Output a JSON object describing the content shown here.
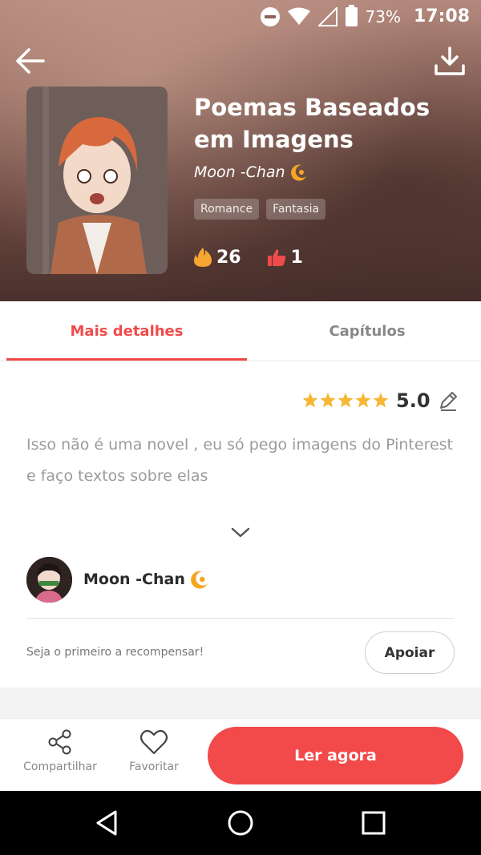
{
  "status_bar": {
    "battery_pct": "73%",
    "time": "17:08"
  },
  "book": {
    "title": "Poemas Baseados em Imagens",
    "author": "Moon -Chan",
    "tags": [
      "Romance",
      "Fantasia"
    ],
    "fire_count": "26",
    "like_count": "1"
  },
  "tabs": {
    "details": "Mais detalhes",
    "chapters": "Capítulos"
  },
  "details": {
    "rating": "5.0",
    "stars_filled": 5,
    "description": "Isso não é uma novel , eu só pego imagens do Pinterest e faço textos sobre elas",
    "author_name": "Moon -Chan",
    "reward_text": "Seja o primeiro a recompensar!",
    "support_label": "Apoiar"
  },
  "actions": {
    "share": "Compartilhar",
    "favorite": "Favoritar",
    "read": "Ler agora"
  },
  "colors": {
    "accent": "#f04a4a",
    "star": "#f7b733",
    "badge": "#f5a623"
  }
}
